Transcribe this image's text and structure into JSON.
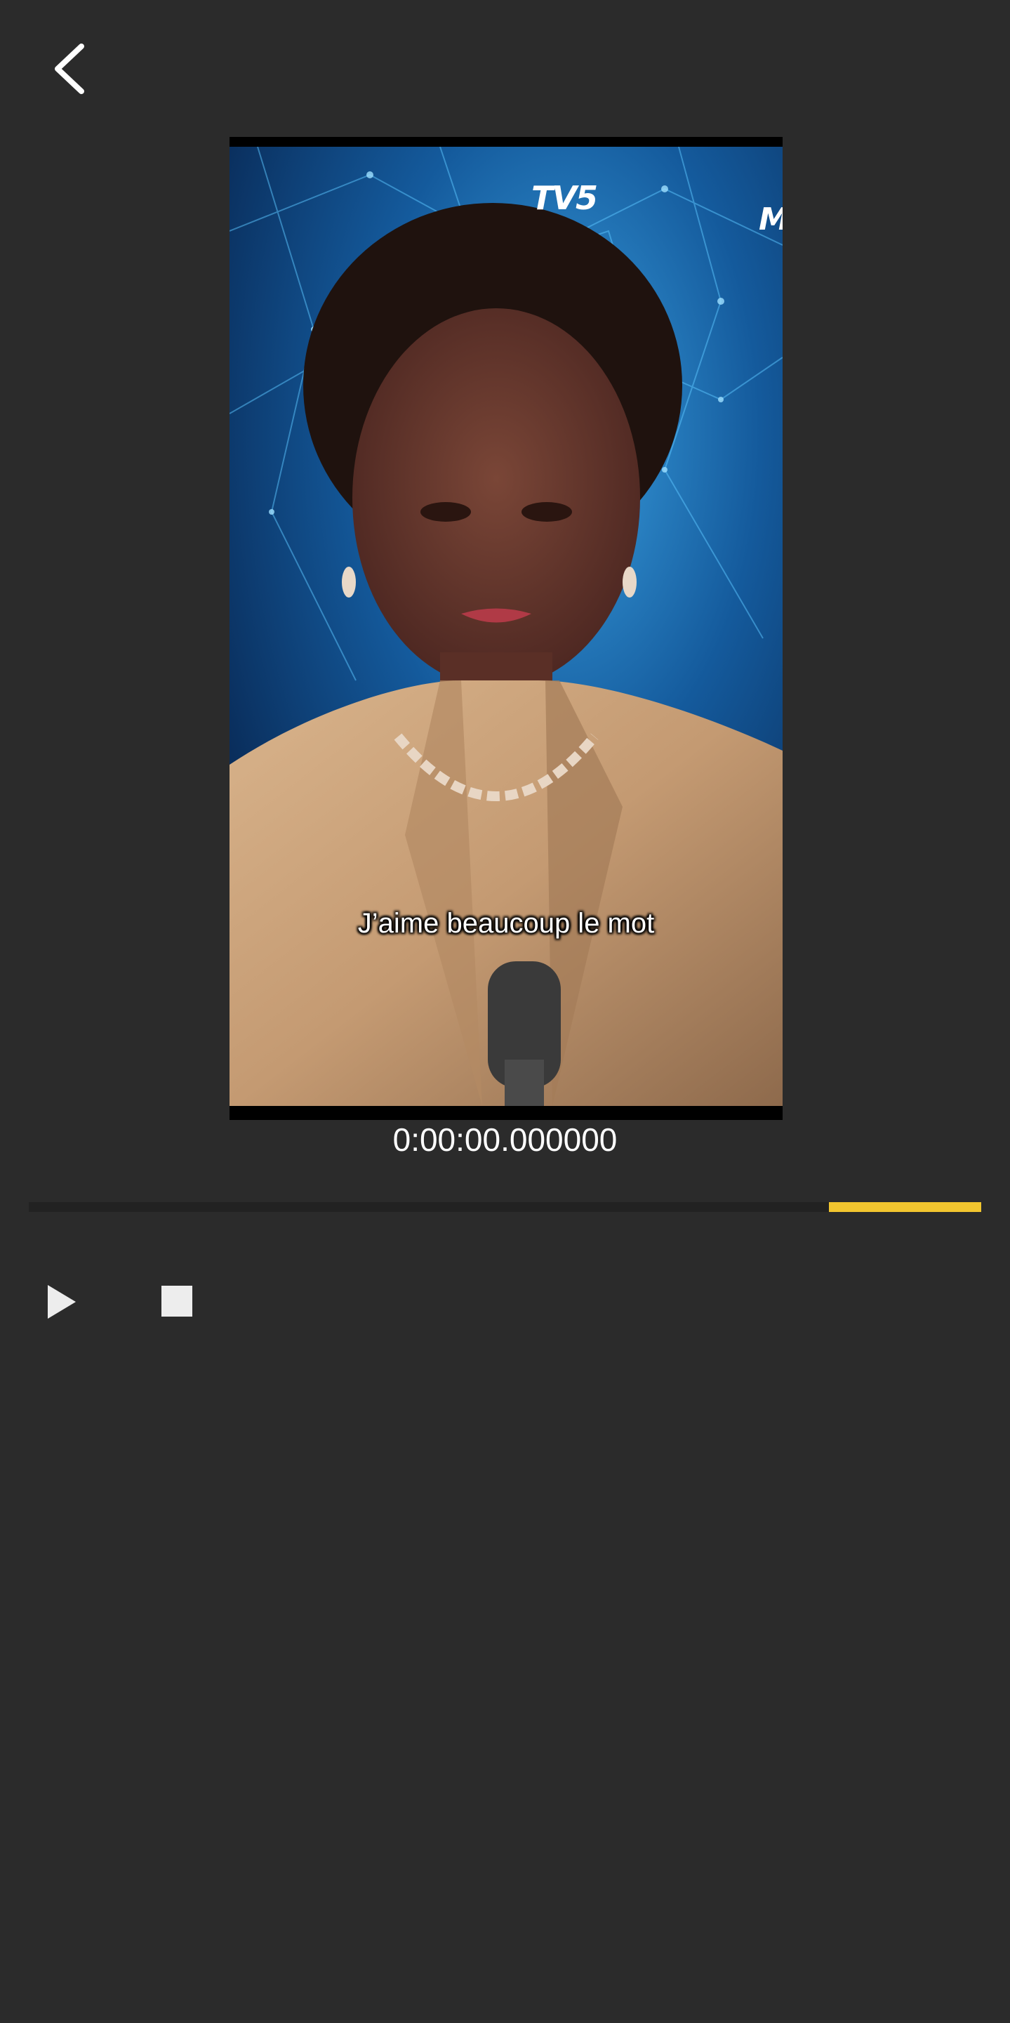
{
  "header": {
    "back_icon": "chevron-left-icon"
  },
  "video": {
    "channel_logo": "TV5",
    "channel_mark": "M",
    "subtitle": "J’aime beaucoup le mot"
  },
  "player": {
    "timecode": "0:00:00.000000",
    "timeline": {
      "selection_start_fraction": 0.84,
      "selection_end_fraction": 1.0,
      "selection_color": "#f2c62f",
      "track_color": "#222222"
    },
    "controls": {
      "play_icon": "play-icon",
      "stop_icon": "stop-icon"
    }
  },
  "colors": {
    "background": "#2b2b2b",
    "accent": "#f2c62f"
  }
}
